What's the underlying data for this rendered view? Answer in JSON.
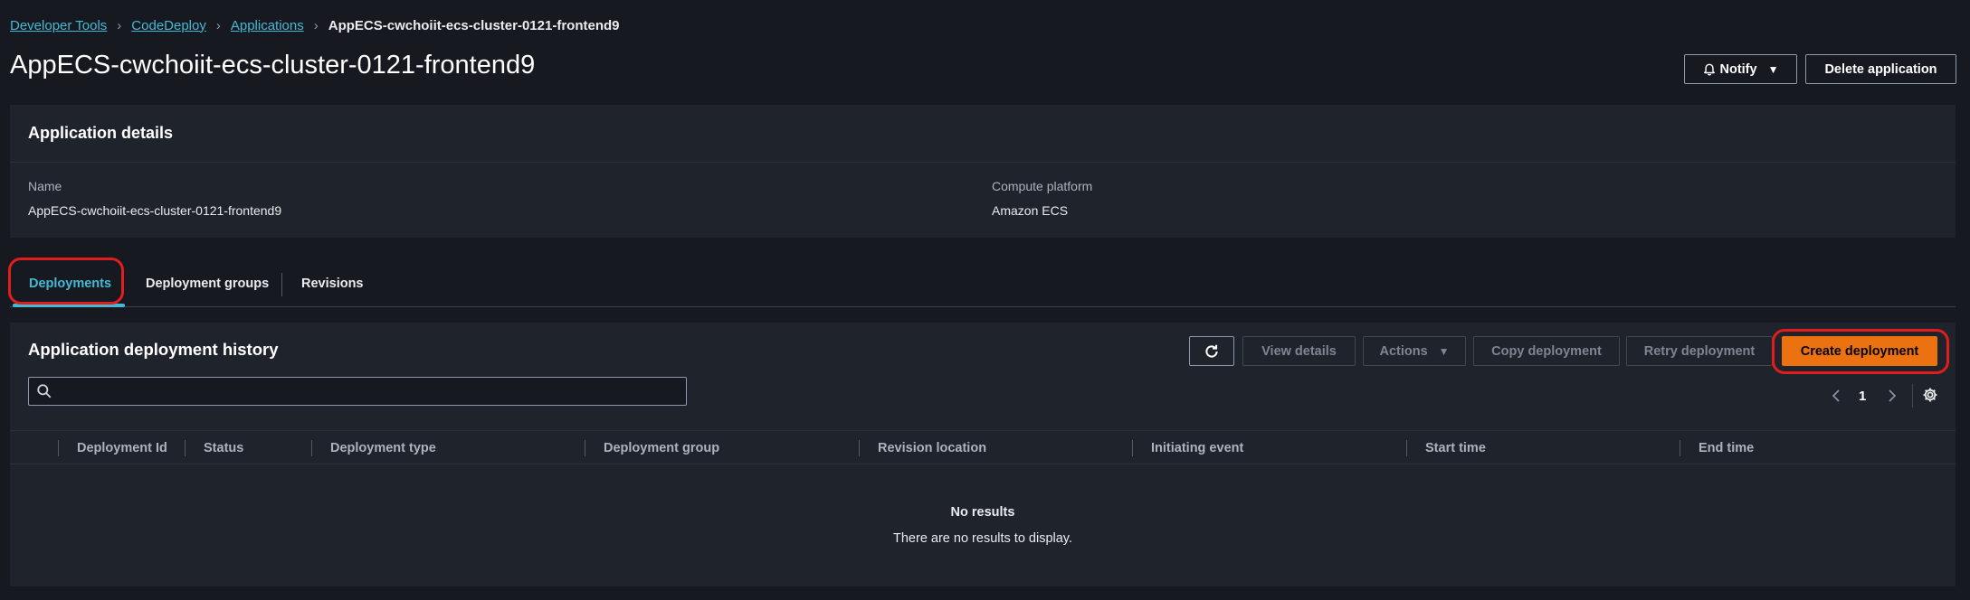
{
  "breadcrumb": {
    "items": [
      "Developer Tools",
      "CodeDeploy",
      "Applications"
    ],
    "current": "AppECS-cwchoiit-ecs-cluster-0121-frontend9"
  },
  "header": {
    "title": "AppECS-cwchoiit-ecs-cluster-0121-frontend9",
    "notify_label": "Notify",
    "delete_label": "Delete application"
  },
  "details": {
    "title": "Application details",
    "name_label": "Name",
    "name_value": "AppECS-cwchoiit-ecs-cluster-0121-frontend9",
    "platform_label": "Compute platform",
    "platform_value": "Amazon ECS"
  },
  "tabs": [
    {
      "label": "Deployments",
      "active": true
    },
    {
      "label": "Deployment groups",
      "active": false
    },
    {
      "label": "Revisions",
      "active": false
    }
  ],
  "history": {
    "title": "Application deployment history",
    "buttons": {
      "view_details": "View details",
      "actions": "Actions",
      "copy": "Copy deployment",
      "retry": "Retry deployment",
      "create": "Create deployment"
    },
    "search_placeholder": "",
    "page": "1",
    "columns": [
      "Deployment Id",
      "Status",
      "Deployment type",
      "Deployment group",
      "Revision location",
      "Initiating event",
      "Start time",
      "End time"
    ],
    "empty_title": "No results",
    "empty_message": "There are no results to display."
  },
  "colors": {
    "background": "#16191f",
    "panel": "#1f232b",
    "link": "#44b9d6",
    "primary": "#ec7211",
    "highlight_ring": "#e11d1d"
  }
}
